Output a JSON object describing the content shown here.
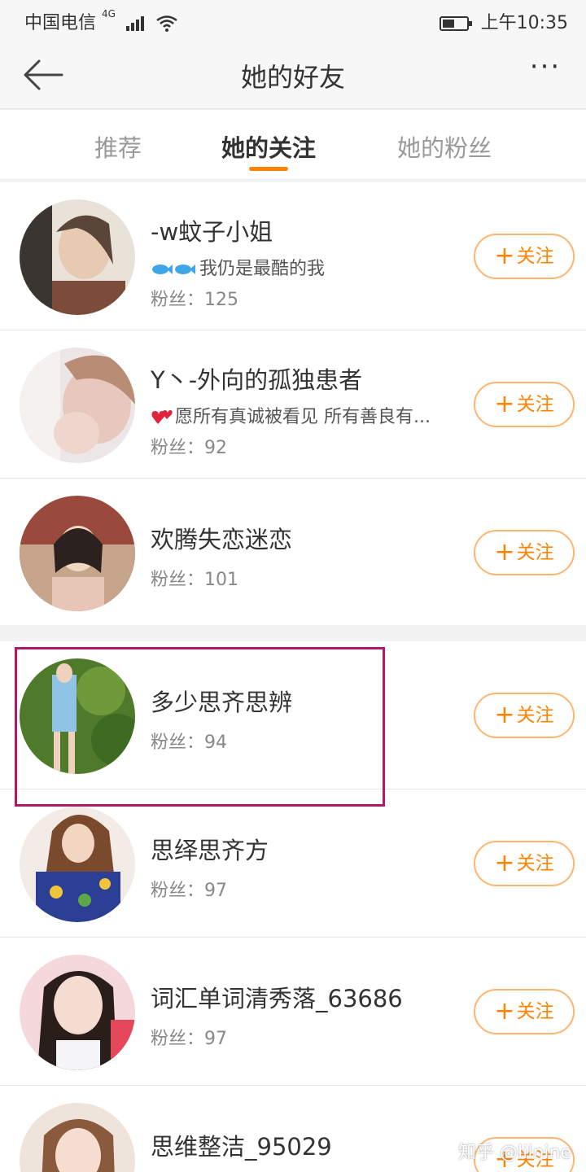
{
  "status_bar": {
    "carrier": "中国电信",
    "network": "4G",
    "time": "上午10:35"
  },
  "nav": {
    "title": "她的好友",
    "more": "···"
  },
  "tabs": [
    {
      "label": "推荐",
      "active": false
    },
    {
      "label": "她的关注",
      "active": true
    },
    {
      "label": "她的粉丝",
      "active": false
    }
  ],
  "users": [
    {
      "name": "-w蚊子小姐",
      "bio": "我仍是最酷的我",
      "bio_icon": "fish-emoji",
      "fans": "粉丝：125",
      "follow": "关注"
    },
    {
      "name": "Y丶-外向的孤独患者",
      "bio": "愿所有真诚被看见 所有善良有...",
      "bio_icon": "hearts-emoji",
      "fans": "粉丝：92",
      "follow": "关注"
    },
    {
      "name": "欢腾失恋迷恋",
      "fans": "粉丝：101",
      "follow": "关注"
    },
    {
      "name": "多少思齐思辨",
      "fans": "粉丝：94",
      "follow": "关注"
    },
    {
      "name": "思绎思齐方",
      "fans": "粉丝：97",
      "follow": "关注"
    },
    {
      "name": "词汇单词清秀落_63686",
      "fans": "粉丝：97",
      "follow": "关注"
    },
    {
      "name": "思维整洁_95029",
      "follow": "关注"
    }
  ],
  "follow_plus": "+",
  "watermark": "知乎 @lilnine",
  "colors": {
    "accent": "#ff8200",
    "highlight": "#b0186c"
  }
}
